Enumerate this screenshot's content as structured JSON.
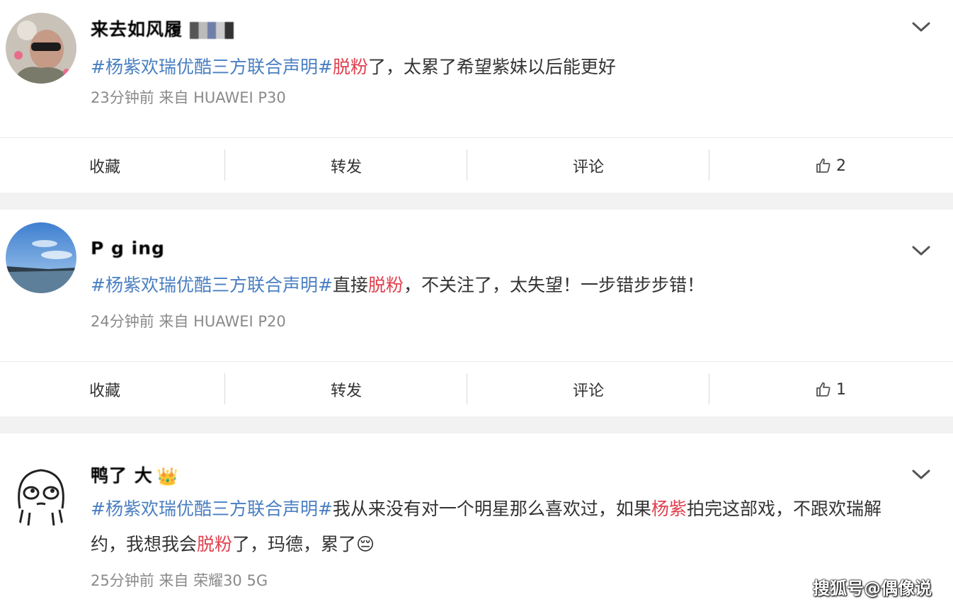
{
  "posts": [
    {
      "username": "来去如风履",
      "text": [
        {
          "t": "#杨紫欢瑞优酷三方联合声明#",
          "c": "tag"
        },
        {
          "t": "脱粉",
          "c": "kw"
        },
        {
          "t": "了，太累了希望紫妹以后能更好",
          "c": "plain"
        }
      ],
      "meta": "23分钟前  来自 HUAWEI P30",
      "actions": {
        "collect": "收藏",
        "repost": "转发",
        "comment": "评论",
        "likes": "2"
      }
    },
    {
      "username": "P         g ing",
      "text": [
        {
          "t": "#杨紫欢瑞优酷三方联合声明#",
          "c": "tag"
        },
        {
          "t": "直接",
          "c": "plain"
        },
        {
          "t": "脱粉",
          "c": "kw"
        },
        {
          "t": "，不关注了，太失望！一步错步步错！",
          "c": "plain"
        }
      ],
      "meta": "24分钟前  来自 HUAWEI P20",
      "actions": {
        "collect": "收藏",
        "repost": "转发",
        "comment": "评论",
        "likes": "1"
      }
    },
    {
      "username": "鸭了    大",
      "text": [
        {
          "t": "#杨紫欢瑞优酷三方联合声明#",
          "c": "tag"
        },
        {
          "t": "我从来没有对一个明星那么喜欢过，如果",
          "c": "plain"
        },
        {
          "t": "杨紫",
          "c": "kw"
        },
        {
          "t": "拍完这部戏，不跟欢瑞解约，我想我会",
          "c": "plain"
        },
        {
          "t": "脱粉",
          "c": "kw"
        },
        {
          "t": "了，玛德，累了😔",
          "c": "plain"
        }
      ],
      "meta": "25分钟前  来自 荣耀30 5G"
    }
  ],
  "watermark": "搜狐号@偶像说",
  "colors": {
    "hashtag": "#4a7fc1",
    "keyword": "#e0414f",
    "meta": "#8a8a8a",
    "page_bg": "#f2f2f2"
  },
  "icons": {
    "expand": "chevron-down-icon",
    "like": "thumbs-up-icon",
    "member": "crown-icon"
  }
}
